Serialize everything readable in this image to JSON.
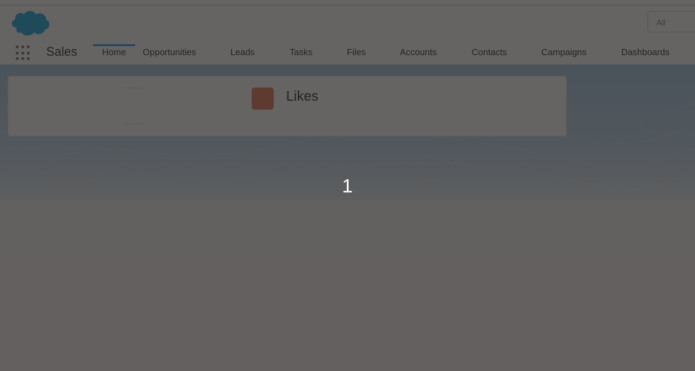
{
  "header": {
    "logo_icon": "salesforce-cloud-logo",
    "search": {
      "scope_label": "All"
    }
  },
  "nav": {
    "app_launcher_icon": "app-launcher-grid-icon",
    "app_name": "Sales",
    "items": [
      {
        "label": "Home",
        "active": true
      },
      {
        "label": "Opportunities"
      },
      {
        "label": "Leads"
      },
      {
        "label": "Tasks"
      },
      {
        "label": "Files"
      },
      {
        "label": "Accounts"
      },
      {
        "label": "Contacts"
      },
      {
        "label": "Campaigns"
      },
      {
        "label": "Dashboards"
      }
    ]
  },
  "card": {
    "icon": "likes-icon",
    "title": "Likes"
  },
  "modal": {
    "counter": "1"
  },
  "colors": {
    "brand_blue": "#1b96ff",
    "logo_blue": "#00a1e0",
    "overlay": "#2b2826",
    "card_icon": "#e16850"
  }
}
